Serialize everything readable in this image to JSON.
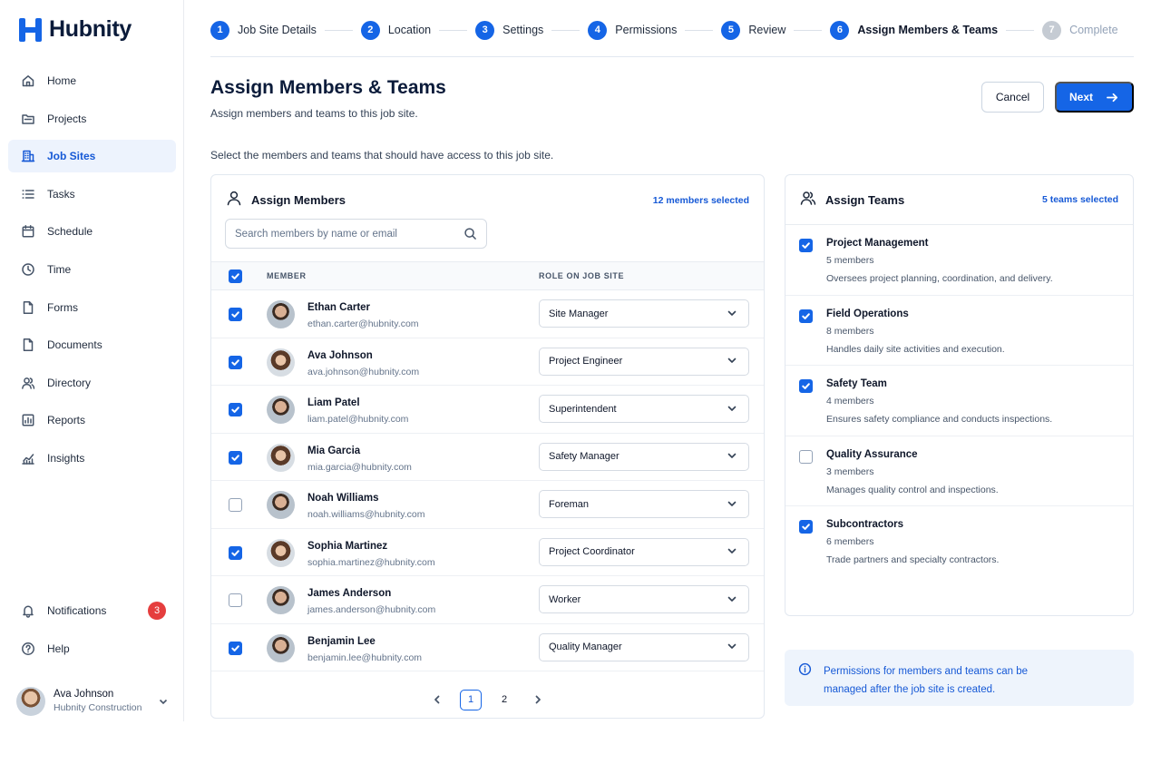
{
  "app": {
    "name": "Hubnity"
  },
  "sidebar": {
    "items": [
      {
        "label": "Home",
        "icon": "home-icon"
      },
      {
        "label": "Projects",
        "icon": "folder-icon"
      },
      {
        "label": "Job Sites",
        "icon": "building-icon",
        "active": true
      },
      {
        "label": "Tasks",
        "icon": "list-icon"
      },
      {
        "label": "Schedule",
        "icon": "calendar-icon"
      },
      {
        "label": "Time",
        "icon": "clock-icon"
      },
      {
        "label": "Forms",
        "icon": "file-icon"
      },
      {
        "label": "Documents",
        "icon": "document-icon"
      },
      {
        "label": "Directory",
        "icon": "users-icon"
      },
      {
        "label": "Reports",
        "icon": "report-icon"
      },
      {
        "label": "Insights",
        "icon": "chart-icon"
      }
    ],
    "bottom": [
      {
        "label": "Notifications",
        "icon": "bell-icon",
        "badge": "3"
      },
      {
        "label": "Help",
        "icon": "help-icon"
      }
    ],
    "user": {
      "name": "Ava Johnson",
      "org": "Hubnity Construction"
    }
  },
  "stepper": {
    "steps": [
      {
        "num": "1",
        "label": "Job Site Details",
        "state": "done"
      },
      {
        "num": "2",
        "label": "Location",
        "state": "done"
      },
      {
        "num": "3",
        "label": "Settings",
        "state": "done"
      },
      {
        "num": "4",
        "label": "Permissions",
        "state": "done"
      },
      {
        "num": "5",
        "label": "Review",
        "state": "done"
      },
      {
        "num": "6",
        "label": "Assign Members & Teams",
        "state": "current"
      },
      {
        "num": "7",
        "label": "Complete",
        "state": "disabled"
      }
    ]
  },
  "header": {
    "title": "Assign Members & Teams",
    "subtitle": "Assign members and teams to this job site.",
    "cancel_label": "Cancel",
    "next_label": "Next"
  },
  "instructions": "Select the members and teams that should have access to this job site.",
  "members": {
    "title": "Assign Members",
    "selected_count": "12 members selected",
    "search_placeholder": "Search members by name or email",
    "columns": {
      "member": "MEMBER",
      "role": "ROLE ON JOB SITE"
    },
    "select_all_checked": true,
    "rows": [
      {
        "name": "Ethan Carter",
        "email": "ethan.carter@hubnity.com",
        "role": "Site Manager",
        "checked": true,
        "avatar": "m"
      },
      {
        "name": "Ava Johnson",
        "email": "ava.johnson@hubnity.com",
        "role": "Project Engineer",
        "checked": true,
        "avatar": "f"
      },
      {
        "name": "Liam Patel",
        "email": "liam.patel@hubnity.com",
        "role": "Superintendent",
        "checked": true,
        "avatar": "m"
      },
      {
        "name": "Mia Garcia",
        "email": "mia.garcia@hubnity.com",
        "role": "Safety Manager",
        "checked": true,
        "avatar": "f"
      },
      {
        "name": "Noah Williams",
        "email": "noah.williams@hubnity.com",
        "role": "Foreman",
        "checked": false,
        "avatar": "m"
      },
      {
        "name": "Sophia Martinez",
        "email": "sophia.martinez@hubnity.com",
        "role": "Project Coordinator",
        "checked": true,
        "avatar": "f"
      },
      {
        "name": "James Anderson",
        "email": "james.anderson@hubnity.com",
        "role": "Worker",
        "checked": false,
        "avatar": "m"
      },
      {
        "name": "Benjamin Lee",
        "email": "benjamin.lee@hubnity.com",
        "role": "Quality Manager",
        "checked": true,
        "avatar": "m"
      }
    ],
    "pagination": {
      "pages": [
        "1",
        "2"
      ],
      "current": "1"
    }
  },
  "teams": {
    "title": "Assign Teams",
    "selected_count": "5 teams selected",
    "items": [
      {
        "name": "Project Management",
        "count": "5 members",
        "desc": "Oversees project planning, coordination, and delivery.",
        "checked": true
      },
      {
        "name": "Field Operations",
        "count": "8 members",
        "desc": "Handles daily site activities and execution.",
        "checked": true
      },
      {
        "name": "Safety Team",
        "count": "4 members",
        "desc": "Ensures safety compliance and conducts inspections.",
        "checked": true
      },
      {
        "name": "Quality Assurance",
        "count": "3 members",
        "desc": "Manages quality control and inspections.",
        "checked": false
      },
      {
        "name": "Subcontractors",
        "count": "6 members",
        "desc": "Trade partners and specialty contractors.",
        "checked": true
      }
    ]
  },
  "info": {
    "text": "Permissions for members and teams can be managed after the job site is created."
  },
  "colors": {
    "accent": "#1565e6",
    "badge": "#e53e3e",
    "info_bg": "#eef4fc"
  }
}
